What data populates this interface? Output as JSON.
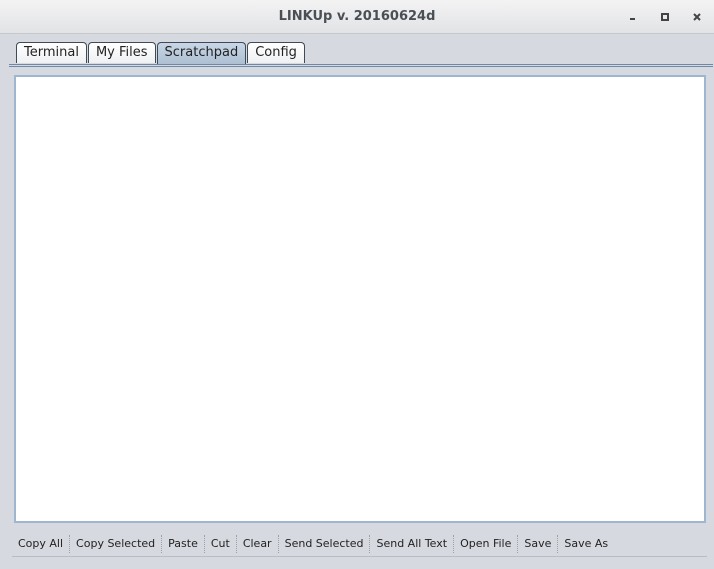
{
  "window": {
    "title": "LINKUp v. 20160624d",
    "controls": [
      "minimize-icon",
      "maximize-icon",
      "close-icon"
    ]
  },
  "tabs": [
    {
      "label": "Terminal",
      "active": false
    },
    {
      "label": "My Files",
      "active": false
    },
    {
      "label": "Scratchpad",
      "active": true
    },
    {
      "label": "Config",
      "active": false
    }
  ],
  "scratchpad": {
    "text": ""
  },
  "toolbar": {
    "copy_all": "Copy All",
    "copy_selected": "Copy Selected",
    "paste": "Paste",
    "cut": "Cut",
    "clear": "Clear",
    "send_selected": "Send Selected",
    "send_all_text": "Send All Text",
    "open_file": "Open File",
    "save": "Save",
    "save_as": "Save As"
  },
  "colors": {
    "window_bg": "#d6d9df",
    "active_tab": "#b9c9db",
    "text_area_border": "#9fb6cf"
  }
}
